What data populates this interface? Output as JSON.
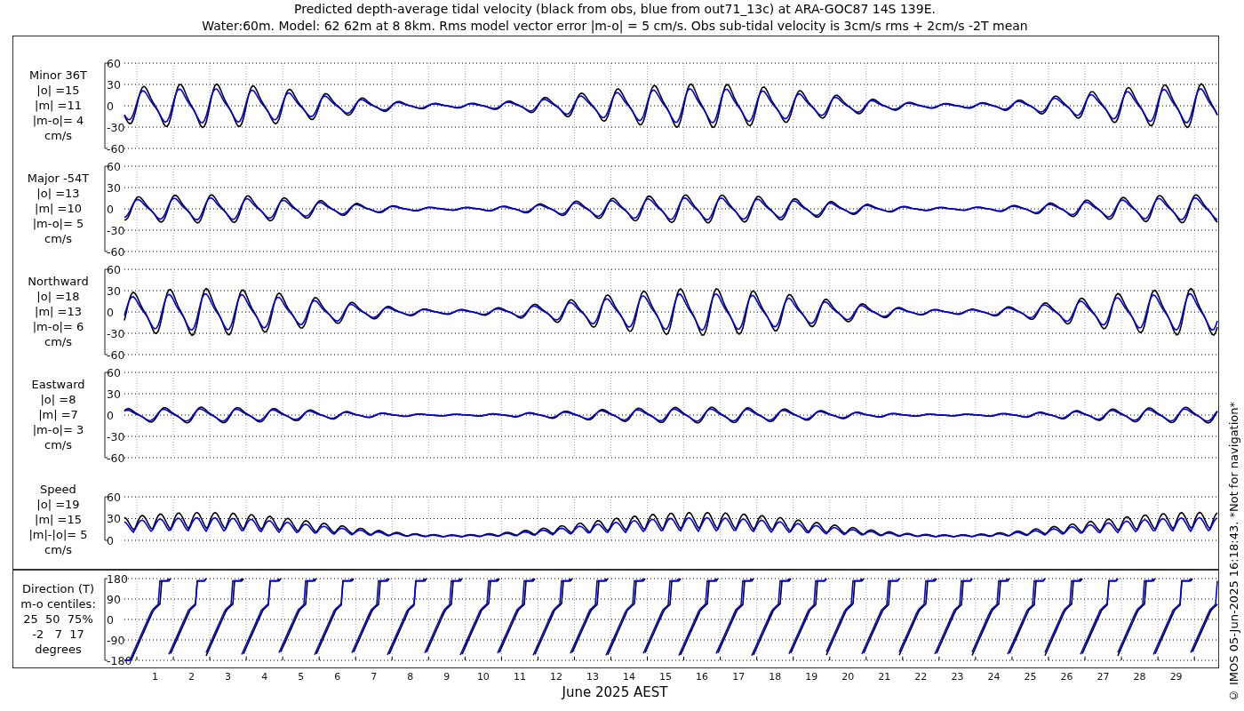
{
  "title_lines": [
    "Predicted depth-average tidal velocity (black from obs, blue from out71_13c) at ARA-GOC87 14S 139E.",
    "Water:60m. Model: 62 62m at 8 8km. Rms model vector error |m-o| = 5 cm/s. Obs sub-tidal velocity is 3cm/s rms + 2cm/s -2T mean"
  ],
  "panels": [
    {
      "kind": "velocity",
      "label_lines": [
        "Minor 36T",
        "|o| =15",
        "|m| =11",
        "|m-o|= 4",
        "cm/s"
      ],
      "yticks": [
        "60",
        "30",
        "0",
        "-30",
        "-60"
      ]
    },
    {
      "kind": "velocity",
      "label_lines": [
        "Major -54T",
        "|o| =13",
        "|m| =10",
        "|m-o|= 5",
        "cm/s"
      ],
      "yticks": [
        "60",
        "30",
        "0",
        "-30",
        "-60"
      ]
    },
    {
      "kind": "velocity",
      "label_lines": [
        "Northward",
        "|o| =18",
        "|m| =13",
        "|m-o|= 6",
        "cm/s"
      ],
      "yticks": [
        "60",
        "30",
        "0",
        "-30",
        "-60"
      ]
    },
    {
      "kind": "velocity",
      "label_lines": [
        "Eastward",
        "|o| =8",
        "|m| =7",
        "|m-o|= 3",
        "cm/s"
      ],
      "yticks": [
        "60",
        "30",
        "0",
        "-30",
        "-60"
      ]
    },
    {
      "kind": "speed",
      "label_lines": [
        "Speed",
        "|o| =19",
        "|m| =15",
        "|m|-|o|= 5",
        "cm/s"
      ],
      "yticks": [
        "60",
        "30",
        "0"
      ]
    },
    {
      "kind": "direction",
      "label_lines": [
        "Direction (T)",
        "m-o centiles:",
        "25  50  75%",
        "-2   7  17",
        "degrees"
      ],
      "yticks": [
        "180",
        "90",
        "0",
        "-90",
        "-180"
      ]
    }
  ],
  "x_axis": {
    "ticks": [
      "1",
      "2",
      "3",
      "4",
      "5",
      "6",
      "7",
      "8",
      "9",
      "10",
      "11",
      "12",
      "13",
      "14",
      "15",
      "16",
      "17",
      "18",
      "19",
      "20",
      "21",
      "22",
      "23",
      "24",
      "25",
      "26",
      "27",
      "28",
      "29"
    ],
    "label": "June 2025 AEST"
  },
  "footer_note": "© IMOS 05-Jun-2025 16:18:43. *Not for navigation*"
}
